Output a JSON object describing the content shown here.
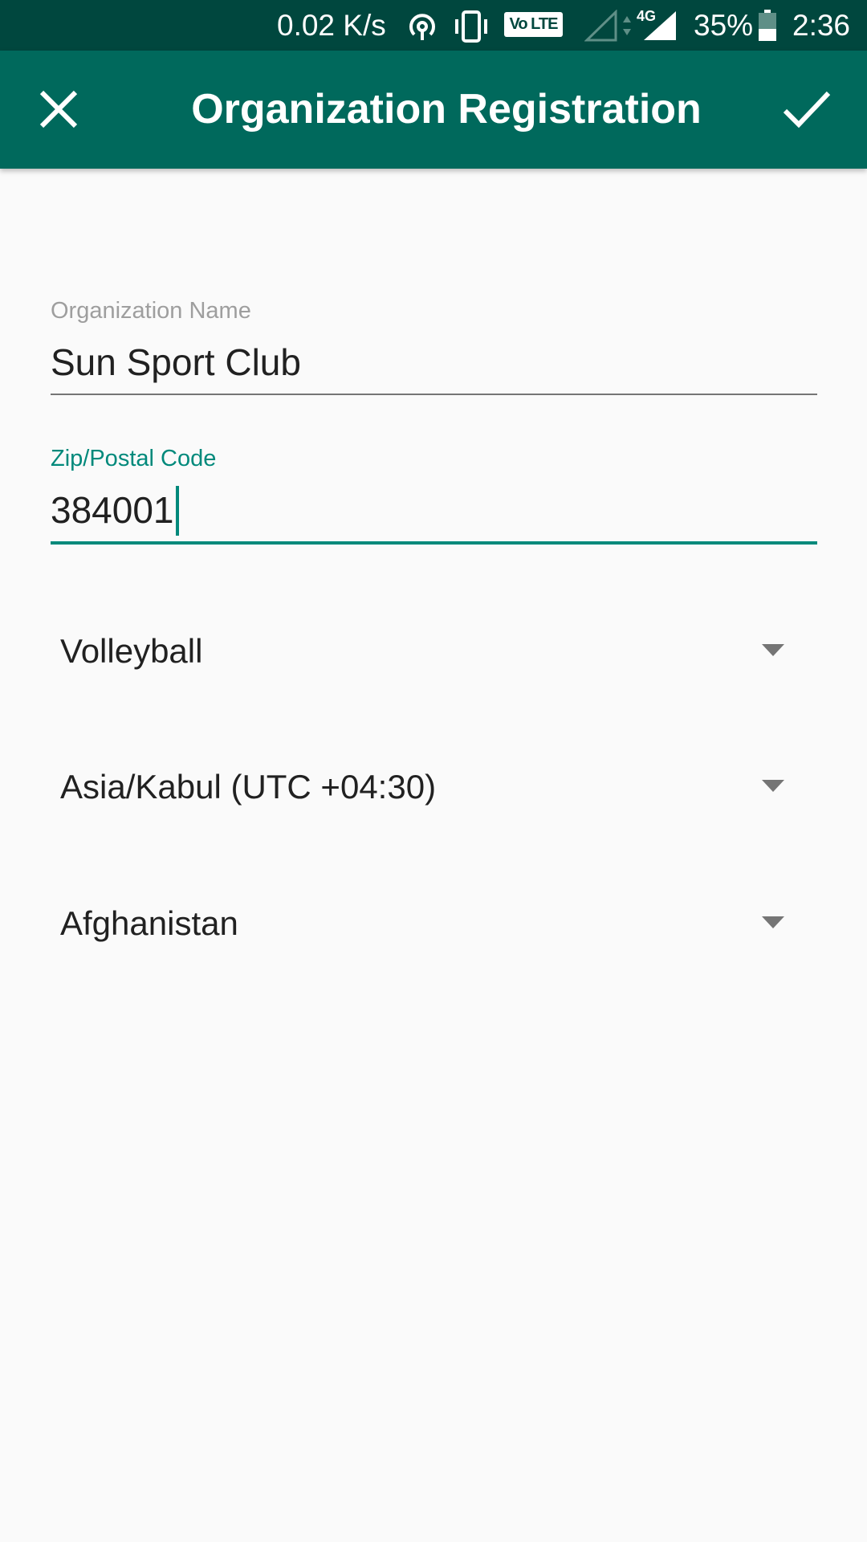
{
  "status_bar": {
    "net_speed": "0.02 K/s",
    "volte": "Vo LTE",
    "network_type": "4G",
    "battery": "35%",
    "time": "2:36",
    "icons": [
      "hotspot-icon",
      "vibrate-icon",
      "signal-empty-icon",
      "data-arrows-icon",
      "signal-icon",
      "battery-icon"
    ]
  },
  "app_bar": {
    "title": "Organization Registration",
    "close_icon": "close-icon",
    "done_icon": "check-icon",
    "background": "#00695c"
  },
  "form": {
    "organization_name": {
      "label": "Organization Name",
      "value": "Sun Sport Club"
    },
    "zip_code": {
      "label": "Zip/Postal Code",
      "value": "384001"
    },
    "sport": {
      "selected": "Volleyball"
    },
    "timezone": {
      "selected": "Asia/Kabul (UTC +04:30)"
    },
    "country": {
      "selected": "Afghanistan"
    }
  },
  "colors": {
    "status_bar": "#00473e",
    "accent": "#00897b",
    "background": "#fafafa"
  }
}
